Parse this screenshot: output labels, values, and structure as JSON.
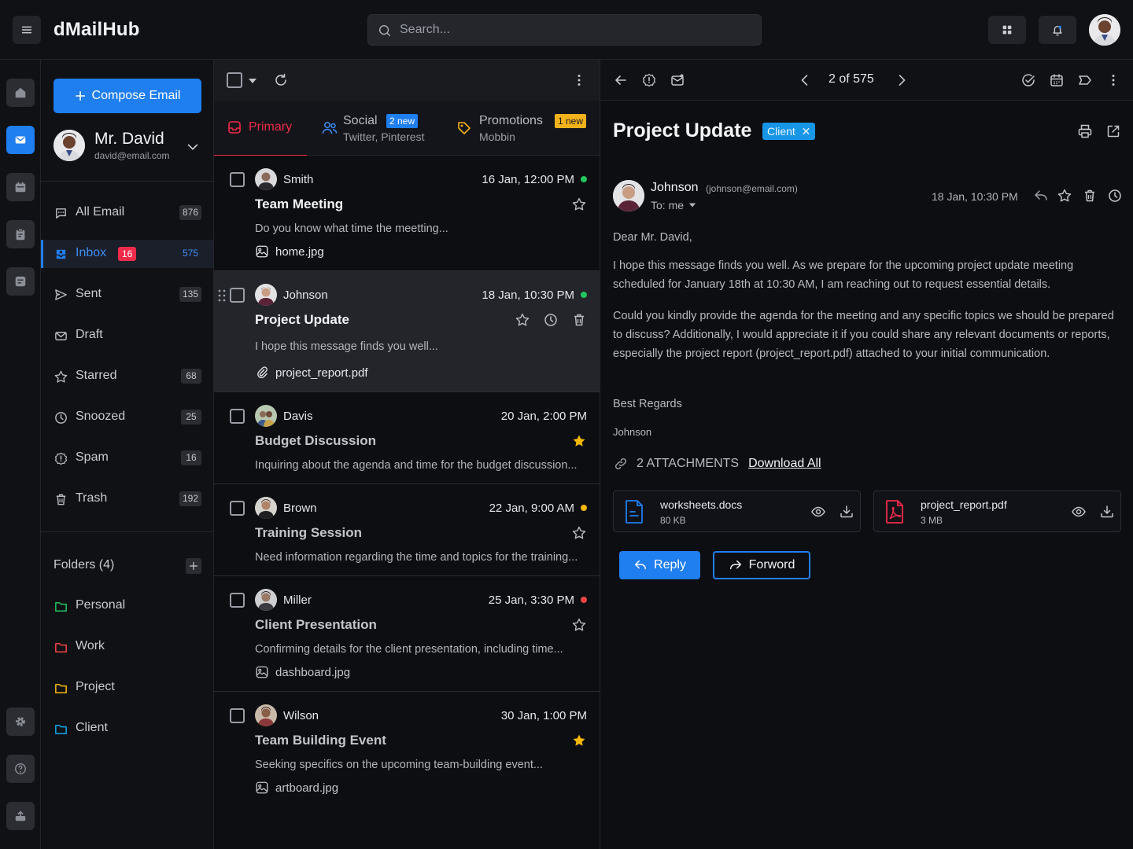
{
  "app": {
    "brand": "dMailHub",
    "search_placeholder": "Search..."
  },
  "sidebar": {
    "compose_label": "Compose Email",
    "profile": {
      "name": "Mr. David",
      "email": "david@email.com"
    },
    "nav": [
      {
        "label": "All Email",
        "count": "876"
      },
      {
        "label": "Inbox",
        "badge": "16",
        "count": "575"
      },
      {
        "label": "Sent",
        "count": "135"
      },
      {
        "label": "Draft",
        "count": ""
      },
      {
        "label": "Starred",
        "count": "68"
      },
      {
        "label": "Snoozed",
        "count": "25"
      },
      {
        "label": "Spam",
        "count": "16"
      },
      {
        "label": "Trash",
        "count": "192"
      }
    ],
    "folders_title": "Folders (4)",
    "folders": [
      {
        "label": "Personal",
        "color": "#22c55e"
      },
      {
        "label": "Work",
        "color": "#ef4444"
      },
      {
        "label": "Project",
        "color": "#f5b70b"
      },
      {
        "label": "Client",
        "color": "#0ea5e9"
      }
    ]
  },
  "tabs": [
    {
      "label": "Primary",
      "sub": ""
    },
    {
      "label": "Social",
      "badge": "2 new",
      "sub": "Twitter, Pinterest"
    },
    {
      "label": "Promotions",
      "badge": "1 new",
      "sub": "Mobbin"
    }
  ],
  "emails": [
    {
      "sender": "Smith",
      "date": "16 Jan, 12:00 PM",
      "dot": "#22c55e",
      "subject": "Team Meeting",
      "snippet": "Do you know what time the meetting...",
      "attachment": "home.jpg",
      "starred": false
    },
    {
      "sender": "Johnson",
      "date": "18 Jan, 10:30 PM",
      "dot": "#22c55e",
      "subject": "Project Update",
      "snippet": "I hope this message finds you well...",
      "attachment": "project_report.pdf",
      "starred": false
    },
    {
      "sender": "Davis",
      "date": "20 Jan, 2:00 PM",
      "dot": "",
      "subject": "Budget Discussion",
      "snippet": "Inquiring about the agenda and time for the budget discussion...",
      "attachment": "",
      "starred": true
    },
    {
      "sender": "Brown",
      "date": "22 Jan, 9:00 AM",
      "dot": "#f5b70b",
      "subject": "Training Session",
      "snippet": "Need information regarding the time and topics for the training...",
      "attachment": "",
      "starred": false
    },
    {
      "sender": "Miller",
      "date": "25 Jan, 3:30 PM",
      "dot": "#ef4444",
      "subject": "Client Presentation",
      "snippet": "Confirming details for the client presentation, including time...",
      "attachment": "dashboard.jpg",
      "starred": false
    },
    {
      "sender": "Wilson",
      "date": "30 Jan, 1:00 PM",
      "dot": "",
      "subject": "Team Building Event",
      "snippet": "Seeking specifics on the upcoming team-building event...",
      "attachment": "artboard.jpg",
      "starred": true
    }
  ],
  "reader": {
    "pager": "2 of 575",
    "subject": "Project Update",
    "tag": "Client",
    "from_name": "Johnson",
    "from_email": "(johnson@email.com)",
    "to": "To: me",
    "date": "18 Jan, 10:30 PM",
    "greeting": "Dear Mr. David,",
    "p1": "I hope this message finds you well. As we prepare for the upcoming project update meeting scheduled for January 18th at 10:30 AM, I am reaching out to request essential details.",
    "p2": "Could you kindly provide the agenda for the meeting and any specific topics we should be prepared to discuss? Additionally, I would appreciate it if you could share any relevant documents or reports, especially the project report (project_report.pdf) attached to your initial communication.",
    "regards": "Best Regards",
    "signature": "Johnson",
    "attachments_label": "2 ATTACHMENTS",
    "download_all": "Download All",
    "attachments": [
      {
        "name": "worksheets.docs",
        "size": "80 KB"
      },
      {
        "name": "project_report.pdf",
        "size": "3 MB"
      }
    ],
    "reply_label": "Reply",
    "forward_label": "Forword"
  },
  "colors": {
    "accent": "#1f7ef0",
    "danger": "#ee2b4a",
    "warning": "#f3b21b"
  }
}
